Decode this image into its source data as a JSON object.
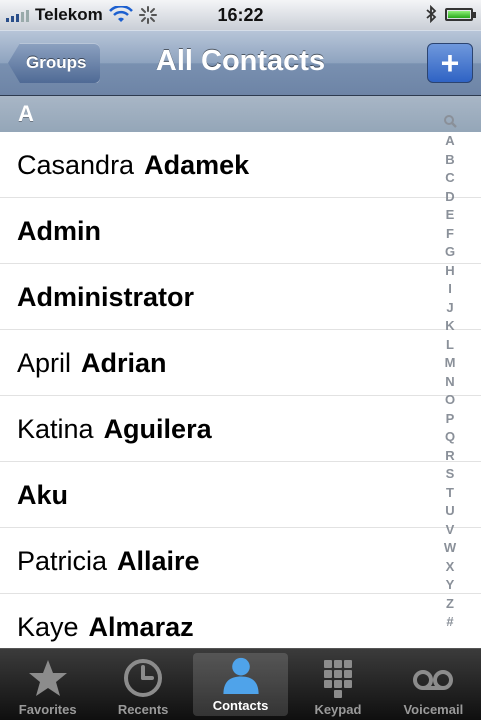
{
  "status_bar": {
    "carrier": "Telekom",
    "time": "16:22"
  },
  "nav": {
    "back_label": "Groups",
    "title": "All Contacts",
    "add_label": "+"
  },
  "section": {
    "letter": "A"
  },
  "contacts": [
    {
      "first": "Casandra",
      "last": "Adamek"
    },
    {
      "first": "",
      "last": "Admin"
    },
    {
      "first": "",
      "last": "Administrator"
    },
    {
      "first": "April",
      "last": "Adrian"
    },
    {
      "first": "Katina",
      "last": "Aguilera"
    },
    {
      "first": "",
      "last": "Aku"
    },
    {
      "first": "Patricia",
      "last": "Allaire"
    },
    {
      "first": "Kaye",
      "last": "Almaraz"
    }
  ],
  "index": [
    "A",
    "B",
    "C",
    "D",
    "E",
    "F",
    "G",
    "H",
    "I",
    "J",
    "K",
    "L",
    "M",
    "N",
    "O",
    "P",
    "Q",
    "R",
    "S",
    "T",
    "U",
    "V",
    "W",
    "X",
    "Y",
    "Z",
    "#"
  ],
  "tabs": [
    {
      "label": "Favorites",
      "icon": "star-icon"
    },
    {
      "label": "Recents",
      "icon": "clock-icon"
    },
    {
      "label": "Contacts",
      "icon": "person-icon",
      "active": true
    },
    {
      "label": "Keypad",
      "icon": "keypad-icon"
    },
    {
      "label": "Voicemail",
      "icon": "voicemail-icon"
    }
  ],
  "colors": {
    "nav_blue": "#7990b0",
    "accent_blue": "#2f63c4",
    "active_tab_icon": "#4fa3ea"
  }
}
